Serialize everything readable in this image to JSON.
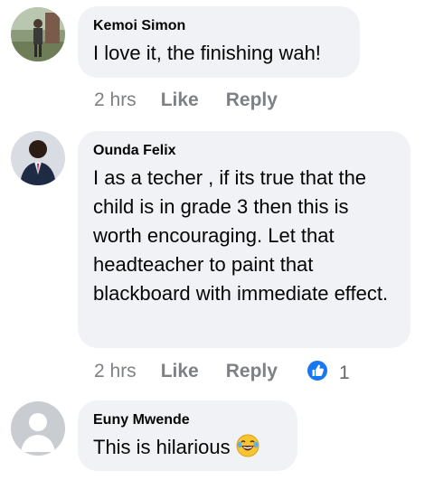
{
  "comments": [
    {
      "author": "Kemoi Simon",
      "text": "I love it, the finishing wah!",
      "time": "2 hrs",
      "like": "Like",
      "reply": "Reply"
    },
    {
      "author": "Ounda Felix",
      "text": "I as a techer , if its true that the child is in grade 3 then this is worth encouraging. Let that headteacher to paint that blackboard with immediate effect.",
      "time": "2 hrs",
      "like": "Like",
      "reply": "Reply",
      "reaction_count": "1"
    },
    {
      "author": "Euny Mwende",
      "text": "This is hilarious",
      "emoji": "laughing-tears-emoji"
    }
  ],
  "colors": {
    "bubble": "#f0f2f5",
    "meta": "#65676b",
    "like_blue": "#1877f2"
  }
}
